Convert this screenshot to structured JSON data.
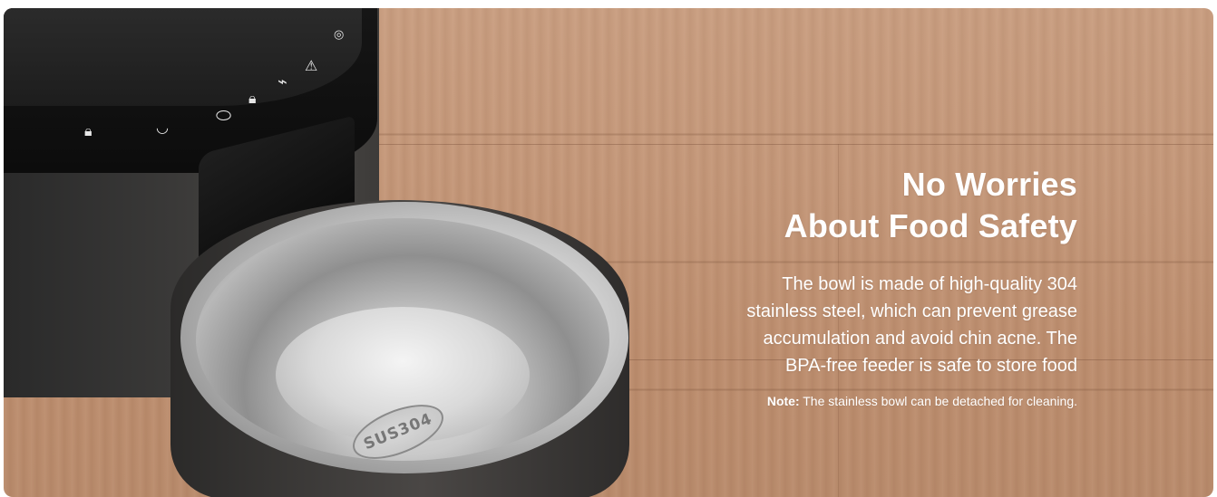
{
  "banner": {
    "headline_line1": "No Worries",
    "headline_line2": "About Food Safety",
    "body_line1": "The bowl is made of high-quality 304",
    "body_line2": "stainless steel, which can prevent grease",
    "body_line3": "accumulation and avoid chin acne. The",
    "body_line4": "BPA-free feeder is safe to store food",
    "note_label": "Note:",
    "note_text": "The stainless bowl can be detached for cleaning."
  },
  "product": {
    "bowl_stamp": "SUS304",
    "panel_icons": [
      "lock-icon",
      "bowl-icon",
      "bowl-icon",
      "lock-icon",
      "wifi-icon",
      "warning-icon",
      "mic-icon"
    ]
  },
  "colors": {
    "wood": "#c49677",
    "feeder": "#3a3938",
    "text": "#ffffff"
  }
}
